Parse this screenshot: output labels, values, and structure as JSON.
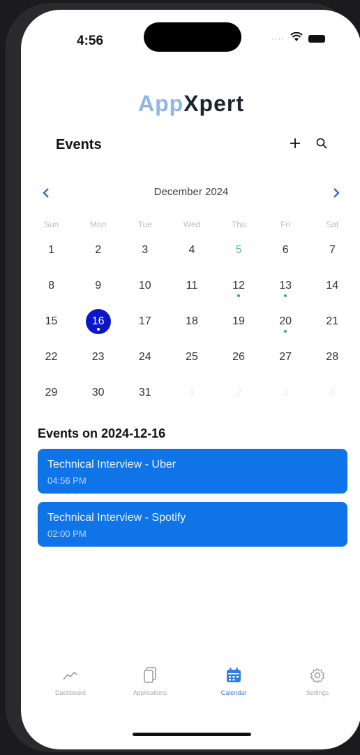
{
  "status_bar": {
    "time": "4:56"
  },
  "app": {
    "logo_part1": "App",
    "logo_part2": "Xpert"
  },
  "header": {
    "title": "Events",
    "add_icon": "plus-icon",
    "search_icon": "search-icon"
  },
  "calendar": {
    "month_label": "December 2024",
    "weekdays": [
      "Sun",
      "Mon",
      "Tue",
      "Wed",
      "Thu",
      "Fri",
      "Sat"
    ],
    "weeks": [
      [
        "1",
        "2",
        "3",
        "4",
        "5",
        "6",
        "7"
      ],
      [
        "8",
        "9",
        "10",
        "11",
        "12",
        "13",
        "14"
      ],
      [
        "15",
        "16",
        "17",
        "18",
        "19",
        "20",
        "21"
      ],
      [
        "22",
        "23",
        "24",
        "25",
        "26",
        "27",
        "28"
      ],
      [
        "29",
        "30",
        "31",
        "1",
        "2",
        "3",
        "4"
      ]
    ],
    "today": "5",
    "selected": "16",
    "days_with_events": [
      "12",
      "13",
      "16",
      "20"
    ]
  },
  "events": {
    "heading": "Events on 2024-12-16",
    "items": [
      {
        "name": "Technical Interview - Uber",
        "time": "04:56 PM"
      },
      {
        "name": "Technical Interview - Spotify",
        "time": "02:00 PM"
      }
    ]
  },
  "tabbar": {
    "items": [
      {
        "label": "Dashboard",
        "icon": "chart-line-icon"
      },
      {
        "label": "Applications",
        "icon": "documents-icon"
      },
      {
        "label": "Calendar",
        "icon": "calendar-icon"
      },
      {
        "label": "Settings",
        "icon": "gear-icon"
      }
    ],
    "active": "Calendar"
  },
  "colors": {
    "accent": "#0e74e8",
    "selected_day": "#0a16c8",
    "event_dot": "#3aa398"
  }
}
